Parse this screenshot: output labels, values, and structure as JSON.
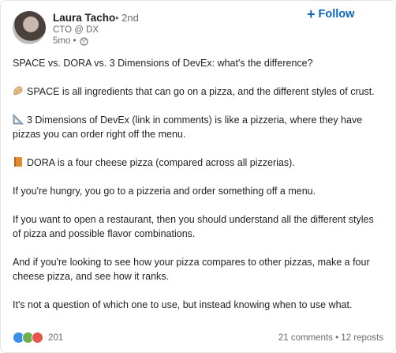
{
  "author": {
    "name": "Laura Tacho",
    "degree": "• 2nd",
    "headline": "CTO @ DX",
    "time": "5mo •"
  },
  "follow_label": "Follow",
  "post": {
    "p1": "SPACE vs. DORA vs. 3 Dimensions of DevEx: what's the difference?",
    "p2": "SPACE is all ingredients that can go on a pizza, and the different styles of crust.",
    "p3": "3 Dimensions of DevEx (link in comments) is like a pizzeria, where they have pizzas you can order right off the menu.",
    "p4": "DORA is a four cheese pizza (compared across all pizzerias).",
    "p5": "If you're hungry, you go to a pizzeria and order something off a menu.",
    "p6": "If you want to open a restaurant, then you should understand all the different styles of pizza and possible flavor combinations.",
    "p7": "And if you're looking to see how your pizza compares to other pizzas, make a four cheese pizza, and see how it ranks.",
    "p8": "It's not a question of which one to use, but instead knowing when to use what."
  },
  "social": {
    "reaction_count": "201",
    "comments": "21 comments",
    "separator": "•",
    "reposts": "12 reposts"
  },
  "colors": {
    "accent": "#0a66c2",
    "like": "#378fe9",
    "support": "#6dae4f",
    "love": "#e4564e"
  },
  "icons": {
    "space": "spiral-shell-icon",
    "devex": "triangular-ruler-icon",
    "dora": "notebook-icon",
    "visibility": "globe-icon"
  }
}
